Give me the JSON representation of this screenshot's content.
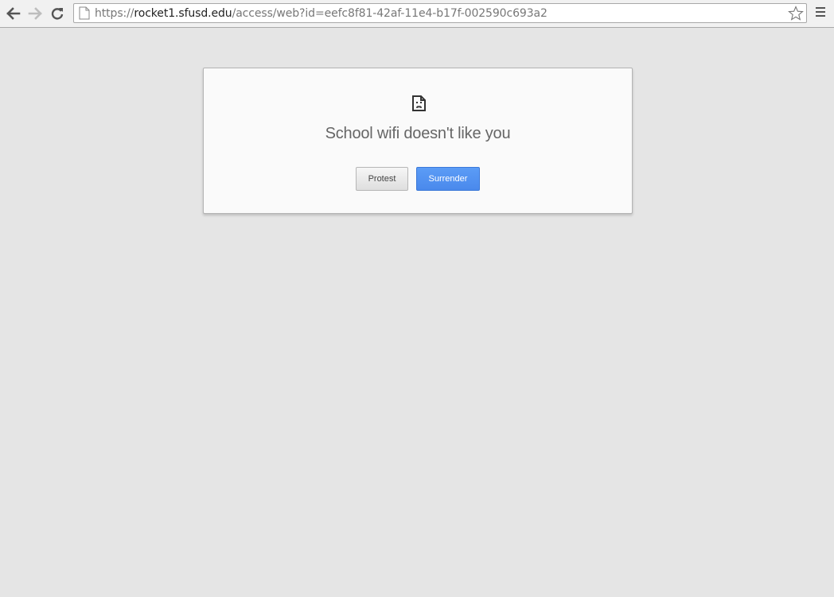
{
  "browser": {
    "url_prefix": "https://",
    "url_host": "rocket1.sfusd.edu",
    "url_path": "/access/web?id=eefc8f81-42af-11e4-b17f-002590c693a2"
  },
  "dialog": {
    "title": "School wifi doesn't like you",
    "protest_label": "Protest",
    "surrender_label": "Surrender"
  },
  "icons": {
    "back": "arrow-left-icon",
    "forward": "arrow-right-icon",
    "reload": "reload-icon",
    "page": "page-icon",
    "bookmark": "star-icon",
    "menu": "hamburger-menu-icon",
    "error": "sad-page-icon"
  },
  "colors": {
    "page_background": "#e5e5e5",
    "accent_button": "#4d8ff0",
    "title_text": "#666666"
  }
}
